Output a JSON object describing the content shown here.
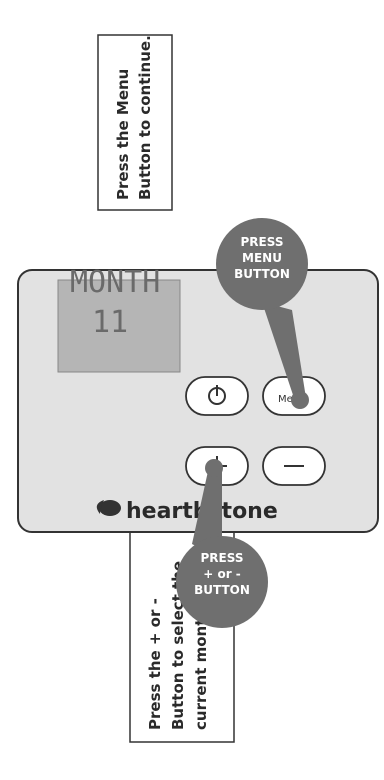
{
  "instructions": {
    "menu_callout": [
      "Press the Menu",
      "Button to continue."
    ],
    "plusminus_callout": [
      "Press the + or -",
      "Button to select the",
      "current month."
    ]
  },
  "bubbles": {
    "menu_bubble": [
      "PRESS",
      "MENU",
      "BUTTON"
    ],
    "plusminus_bubble": [
      "PRESS",
      "+ or -",
      "BUTTON"
    ]
  },
  "display": {
    "line1": "MONTH",
    "line2": "11"
  },
  "buttons": {
    "power_symbol": "⏻",
    "menu_label": "Menu",
    "plus_label": "+",
    "minus_label": "−"
  },
  "brand": {
    "name": "hearthstone",
    "logo_icon": "flame-bird-logo"
  },
  "colors": {
    "remote_body": "#e2e2e2",
    "lcd": "#b7b7b7",
    "bubble": "#6f6f6f",
    "outline": "#333333"
  }
}
